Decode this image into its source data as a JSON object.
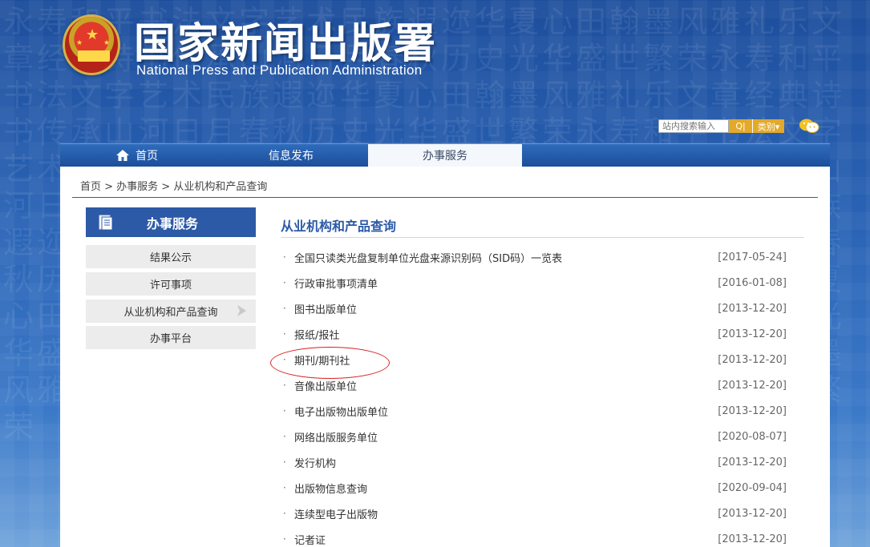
{
  "header": {
    "title": "国家新闻出版署",
    "subtitle": "National Press and Publication Administration",
    "background_glyphs": "永寿和平书法文字艺术民族遐迩华夏心田翰墨风雅礼乐文章经典诗书传承山河日月春秋历史光华盛世繁荣"
  },
  "search": {
    "placeholder": "站内搜索输入",
    "button_label": "Q|",
    "category_label": "类别▾"
  },
  "nav": {
    "items": [
      {
        "label": "首页"
      },
      {
        "label": "信息发布"
      },
      {
        "label": "办事服务"
      }
    ]
  },
  "breadcrumb": {
    "text": "首页 > 办事服务 > 从业机构和产品查询"
  },
  "sidebar": {
    "title": "办事服务",
    "items": [
      {
        "label": "结果公示"
      },
      {
        "label": "许可事项"
      },
      {
        "label": "从业机构和产品查询"
      },
      {
        "label": "办事平台"
      }
    ]
  },
  "main": {
    "title": "从业机构和产品查询",
    "bullet": "·",
    "list": [
      {
        "label": "全国只读类光盘复制单位光盘来源识别码（SID码）一览表",
        "date": "[2017-05-24]"
      },
      {
        "label": "行政审批事项清单",
        "date": "[2016-01-08]"
      },
      {
        "label": "图书出版单位",
        "date": "[2013-12-20]"
      },
      {
        "label": "报纸/报社",
        "date": "[2013-12-20]"
      },
      {
        "label": "期刊/期刊社",
        "date": "[2013-12-20]"
      },
      {
        "label": "音像出版单位",
        "date": "[2013-12-20]"
      },
      {
        "label": "电子出版物出版单位",
        "date": "[2013-12-20]"
      },
      {
        "label": "网络出版服务单位",
        "date": "[2020-08-07]"
      },
      {
        "label": "发行机构",
        "date": "[2013-12-20]"
      },
      {
        "label": "出版物信息查询",
        "date": "[2020-09-04]"
      },
      {
        "label": "连续型电子出版物",
        "date": "[2013-12-20]"
      },
      {
        "label": "记者证",
        "date": "[2013-12-20]"
      }
    ]
  },
  "colors": {
    "accent_blue": "#2c5aa7",
    "search_orange": "#e3a92a",
    "annotation_red": "#d92020"
  }
}
